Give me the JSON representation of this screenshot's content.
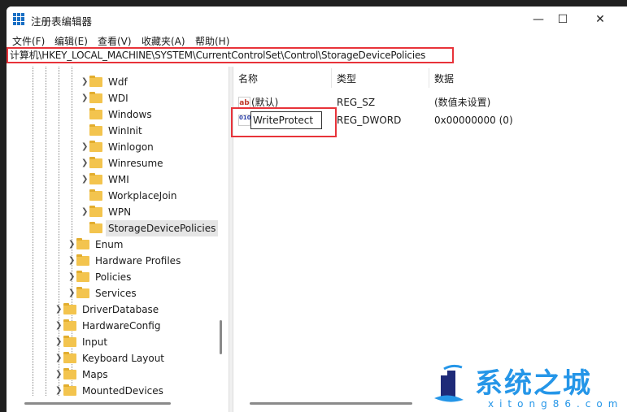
{
  "window": {
    "title": "注册表编辑器",
    "minimize": "—",
    "maximize": "☐",
    "close": "✕"
  },
  "menu": [
    "文件(F)",
    "编辑(E)",
    "查看(V)",
    "收藏夹(A)",
    "帮助(H)"
  ],
  "address": "计算机\\HKEY_LOCAL_MACHINE\\SYSTEM\\CurrentControlSet\\Control\\StorageDevicePolicies",
  "tree": [
    {
      "label": "Wdf",
      "level": 3,
      "expandable": true
    },
    {
      "label": "WDI",
      "level": 3,
      "expandable": true
    },
    {
      "label": "Windows",
      "level": 3,
      "expandable": false
    },
    {
      "label": "WinInit",
      "level": 3,
      "expandable": false
    },
    {
      "label": "Winlogon",
      "level": 3,
      "expandable": true
    },
    {
      "label": "Winresume",
      "level": 3,
      "expandable": true
    },
    {
      "label": "WMI",
      "level": 3,
      "expandable": true
    },
    {
      "label": "WorkplaceJoin",
      "level": 3,
      "expandable": false
    },
    {
      "label": "WPN",
      "level": 3,
      "expandable": true
    },
    {
      "label": "StorageDevicePolicies",
      "level": 3,
      "expandable": false,
      "selected": true
    },
    {
      "label": "Enum",
      "level": 2,
      "expandable": true
    },
    {
      "label": "Hardware Profiles",
      "level": 2,
      "expandable": true
    },
    {
      "label": "Policies",
      "level": 2,
      "expandable": true
    },
    {
      "label": "Services",
      "level": 2,
      "expandable": true
    },
    {
      "label": "DriverDatabase",
      "level": 1,
      "expandable": true
    },
    {
      "label": "HardwareConfig",
      "level": 1,
      "expandable": true
    },
    {
      "label": "Input",
      "level": 1,
      "expandable": true
    },
    {
      "label": "Keyboard Layout",
      "level": 1,
      "expandable": true
    },
    {
      "label": "Maps",
      "level": 1,
      "expandable": true
    },
    {
      "label": "MountedDevices",
      "level": 1,
      "expandable": true
    }
  ],
  "list": {
    "headers": {
      "name": "名称",
      "type": "类型",
      "data": "数据"
    },
    "rows": [
      {
        "icon": "string-value-icon",
        "icon_text": "ab",
        "name": "(默认)",
        "type": "REG_SZ",
        "data": "(数值未设置)"
      },
      {
        "icon": "binary-value-icon",
        "icon_text": "010",
        "name": "WriteProtect",
        "type": "REG_DWORD",
        "data": "0x00000000 (0)",
        "editing": true
      }
    ]
  },
  "watermark": {
    "cn": "系统之城",
    "en": "xitong86.com"
  },
  "colors": {
    "highlight": "#e8333a",
    "logo": "#2596e8",
    "folder": "#f3c44e"
  }
}
